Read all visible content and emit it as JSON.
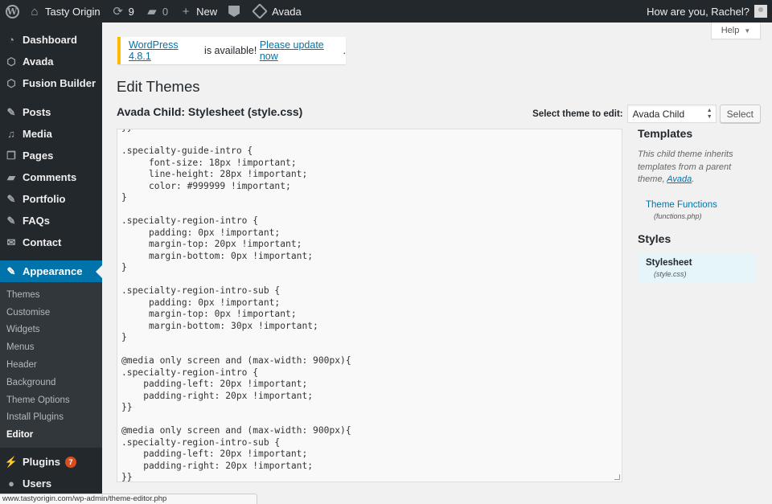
{
  "adminbar": {
    "site_name": "Tasty Origin",
    "updates_count": "9",
    "comments_count": "0",
    "new_label": "New",
    "theme_label": "Avada",
    "greeting": "How are you, Rachel?"
  },
  "sidebar": {
    "top_items": [
      {
        "label": "Dashboard",
        "icon": "dashboard-icon"
      },
      {
        "label": "Avada",
        "icon": "avada-icon"
      },
      {
        "label": "Fusion Builder",
        "icon": "fusion-builder-icon"
      }
    ],
    "items": [
      {
        "label": "Posts",
        "icon": "pin-icon"
      },
      {
        "label": "Media",
        "icon": "media-icon"
      },
      {
        "label": "Pages",
        "icon": "pages-icon"
      },
      {
        "label": "Comments",
        "icon": "comment-icon"
      },
      {
        "label": "Portfolio",
        "icon": "pin-icon"
      },
      {
        "label": "FAQs",
        "icon": "pin-icon"
      },
      {
        "label": "Contact",
        "icon": "mail-icon"
      }
    ],
    "active_item": {
      "label": "Appearance",
      "icon": "brush-icon"
    },
    "submenu": [
      "Themes",
      "Customise",
      "Widgets",
      "Menus",
      "Header",
      "Background",
      "Theme Options",
      "Install Plugins",
      "Editor"
    ],
    "current_sub": "Editor",
    "after_items": [
      {
        "label": "Plugins",
        "icon": "plugin-icon",
        "badge": "7"
      },
      {
        "label": "Users",
        "icon": "users-icon"
      }
    ]
  },
  "main": {
    "help_label": "Help",
    "notice": {
      "link1": "WordPress 4.8.1",
      "middle": " is available! ",
      "link2": "Please update now",
      "end": "."
    },
    "page_title": "Edit Themes",
    "file_title": "Avada Child: Stylesheet (style.css)",
    "select_label": "Select theme to edit:",
    "selected_theme": "Avada Child",
    "select_button": "Select",
    "code": "}}\n\n.specialty-guide-intro {\n     font-size: 18px !important;\n     line-height: 28px !important;\n     color: #999999 !important;\n}\n\n.specialty-region-intro {\n     padding: 0px !important;\n     margin-top: 20px !important;\n     margin-bottom: 0px !important;\n}\n\n.specialty-region-intro-sub {\n     padding: 0px !important;\n     margin-top: 0px !important;\n     margin-bottom: 30px !important;\n}\n\n@media only screen and (max-width: 900px){\n.specialty-region-intro {\n    padding-left: 20px !important;\n    padding-right: 20px !important;\n}}\n\n@media only screen and (max-width: 900px){\n.specialty-region-intro-sub {\n    padding-left: 20px !important;\n    padding-right: 20px !important;\n}}",
    "templates_heading": "Templates",
    "templates_desc": "This child theme inherits templates from a parent theme, ",
    "templates_desc_link": "Avada",
    "templates_desc_end": ".",
    "template_file_name": "Theme Functions",
    "template_file_path": "(functions.php)",
    "styles_heading": "Styles",
    "style_file_name": "Stylesheet",
    "style_file_path": "(style.css)"
  },
  "statusbar": {
    "url": "www.tastyorigin.com/wp-admin/theme-editor.php"
  },
  "colors": {
    "admin_dark": "#23282d",
    "accent": "#0073aa",
    "notice_border": "#ffb900",
    "badge": "#d54e21"
  }
}
